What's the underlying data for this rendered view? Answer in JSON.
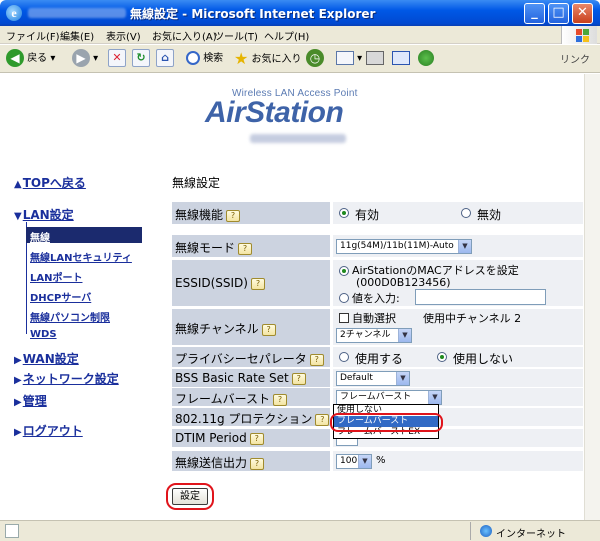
{
  "window": {
    "title": "無線設定 - Microsoft Internet Explorer",
    "ie_letter": "e",
    "minimize_glyph": "_",
    "maximize_glyph": "□",
    "close_glyph": "✕"
  },
  "menu": [
    "ファイル(F)",
    "編集(E)",
    "表示(V)",
    "お気に入り(A)",
    "ツール(T)",
    "ヘルプ(H)"
  ],
  "toolbar": {
    "back": "戻る",
    "back_glyph": "◀",
    "forward_glyph": "▶",
    "stop_glyph": "✕",
    "refresh_glyph": "↻",
    "home_glyph": "⌂",
    "search": "検索",
    "favorites": "お気に入り",
    "link": "リンク"
  },
  "logo": {
    "subtitle": "Wireless LAN Access Point",
    "name": "AirStation"
  },
  "nav": {
    "top": "TOPへ戻る",
    "lan": "LAN設定",
    "wan": "WAN設定",
    "network": "ネットワーク設定",
    "admin": "管理",
    "logout": "ログアウト",
    "sub": [
      "無線",
      "無線LANセキュリティ",
      "LANポート",
      "DHCPサーバ",
      "無線パソコン制限",
      "WDS"
    ]
  },
  "form": {
    "section_title": "無線設定",
    "wireless_func": {
      "label": "無線機能",
      "on": "有効",
      "off": "無効"
    },
    "wireless_mode": {
      "label": "無線モード",
      "value": "11g(54M)/11b(11M)-Auto"
    },
    "essid": {
      "label": "ESSID(SSID)",
      "opt1": "AirStationのMACアドレスを設定",
      "opt1_mac": "(000D0B123456)",
      "opt2": "値を入力:"
    },
    "channel": {
      "label": "無線チャンネル",
      "auto": "自動選択",
      "in_use": "使用中チャンネル 2",
      "value": "2チャンネル"
    },
    "privacy": {
      "label": "プライバシーセパレータ",
      "use": "使用する",
      "nouse": "使用しない"
    },
    "bss": {
      "label": "BSS Basic Rate Set",
      "value": "Default"
    },
    "frameburst": {
      "label": "フレームバースト",
      "value": "フレームバースト",
      "options": [
        "使用しない",
        "フレームバースト",
        "フレームバーストEX"
      ]
    },
    "protection": {
      "label": "802.11g プロテクション"
    },
    "dtim": {
      "label": "DTIM Period"
    },
    "txpower": {
      "label": "無線送信出力",
      "value": "100",
      "unit": "%"
    },
    "submit": "設定"
  },
  "status": {
    "zone": "インターネット"
  }
}
